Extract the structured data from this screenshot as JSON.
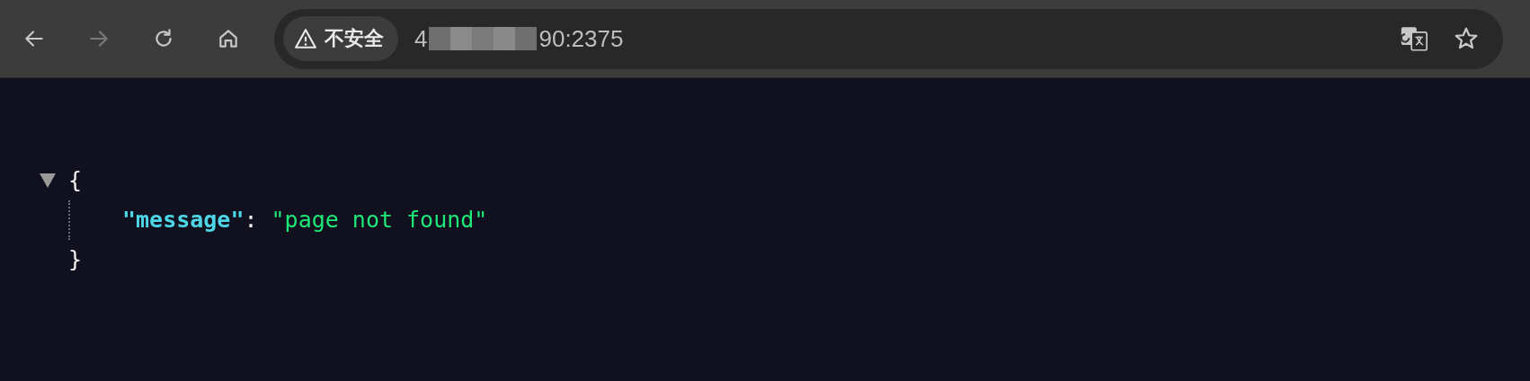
{
  "toolbar": {
    "nav_buttons": [
      {
        "kind": "back",
        "disabled": false
      },
      {
        "kind": "forward",
        "disabled": true
      },
      {
        "kind": "reload",
        "disabled": false
      },
      {
        "kind": "home",
        "disabled": false
      }
    ],
    "address_bar": {
      "security_label": "不安全",
      "url_start": "4",
      "url_end": "90:2375",
      "redacted": true
    },
    "bookmarked": false
  },
  "json_view": {
    "expanded": true,
    "open_brace": "{",
    "close_brace": "}",
    "entries": [
      {
        "key": "\"message\"",
        "colon": ":",
        "value": "\"page not found\""
      }
    ]
  }
}
